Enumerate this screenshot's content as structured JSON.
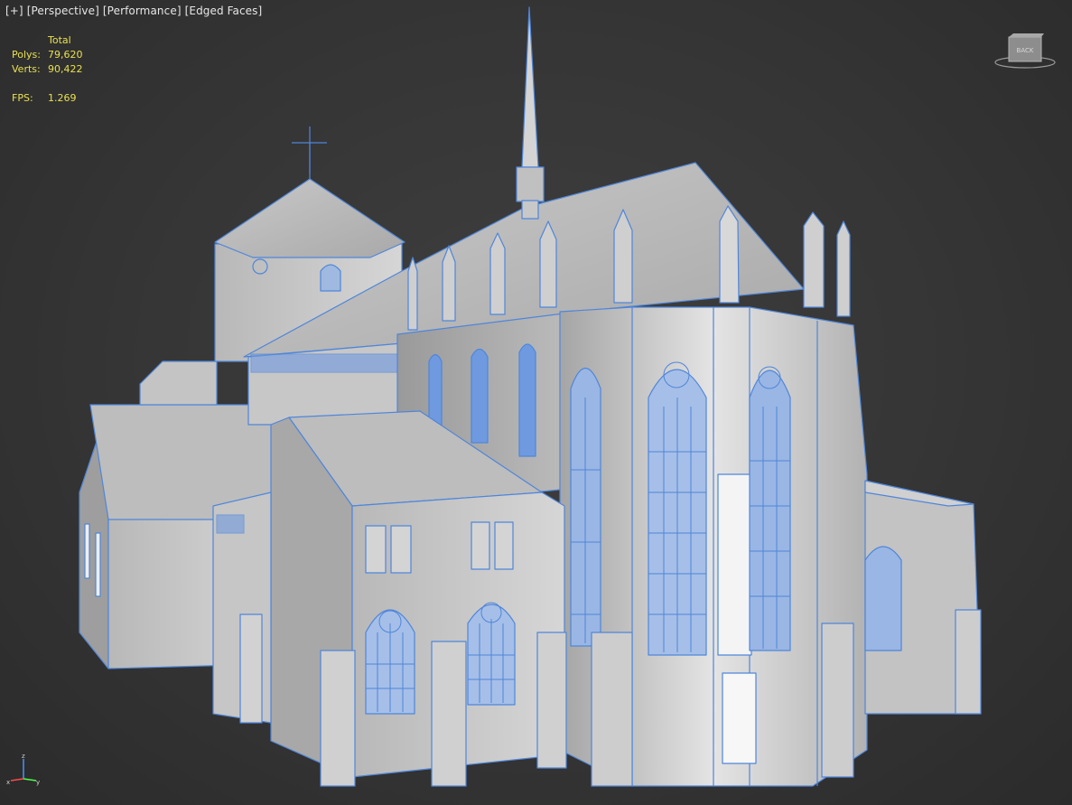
{
  "viewport_label": {
    "plus": "[+]",
    "view": "[Perspective]",
    "mode": "[Performance]",
    "shading": "[Edged Faces]"
  },
  "stats": {
    "header": "Total",
    "polys_label": "Polys:",
    "polys_value": "79,620",
    "verts_label": "Verts:",
    "verts_value": "90,422",
    "fps_label": "FPS:",
    "fps_value": "1.269"
  },
  "viewcube": {
    "face_label": "BACK"
  },
  "axis": {
    "z_label": "z",
    "x_label": "x",
    "y_label": "y"
  },
  "colors": {
    "wire": "#4f86d9",
    "wire_light": "#6fa2ee",
    "stats_text": "#e8e050",
    "background": "#3a3a3a"
  }
}
